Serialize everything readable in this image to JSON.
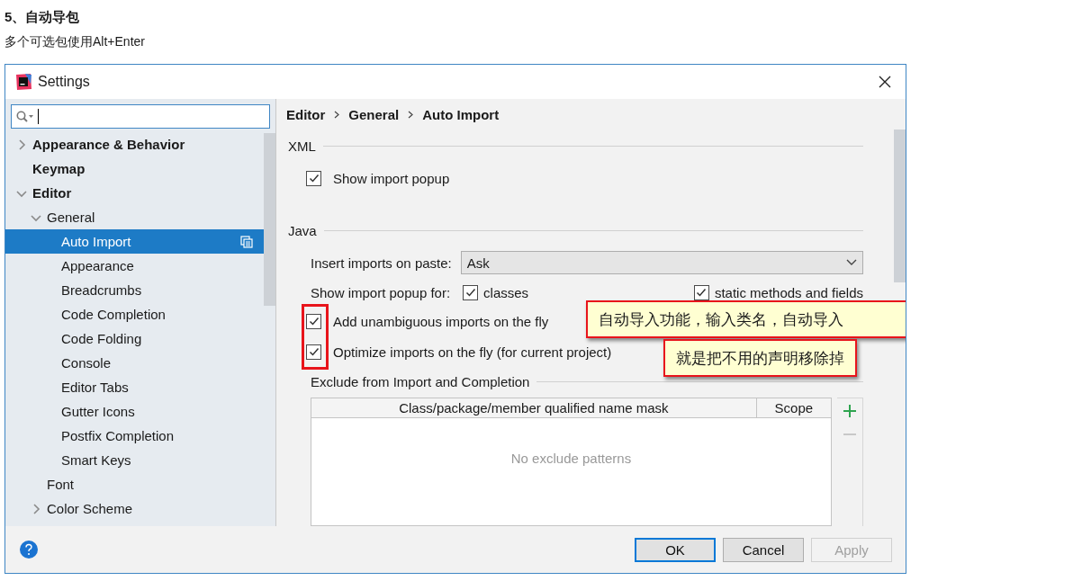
{
  "article": {
    "heading": "5、自动导包",
    "subtitle": "多个可选包使用Alt+Enter"
  },
  "window": {
    "title": "Settings"
  },
  "sidebar": {
    "items": [
      {
        "label": "Appearance & Behavior",
        "expanded": false,
        "selected": false
      },
      {
        "label": "Keymap",
        "selected": false
      },
      {
        "label": "Editor",
        "expanded": true,
        "selected": false,
        "children": [
          {
            "label": "General",
            "expanded": true,
            "selected": false,
            "children": [
              {
                "label": "Auto Import",
                "selected": true,
                "project_scope": true
              },
              {
                "label": "Appearance",
                "selected": false
              },
              {
                "label": "Breadcrumbs",
                "selected": false
              },
              {
                "label": "Code Completion",
                "selected": false
              },
              {
                "label": "Code Folding",
                "selected": false
              },
              {
                "label": "Console",
                "selected": false
              },
              {
                "label": "Editor Tabs",
                "selected": false
              },
              {
                "label": "Gutter Icons",
                "selected": false
              },
              {
                "label": "Postfix Completion",
                "selected": false
              },
              {
                "label": "Smart Keys",
                "selected": false
              }
            ]
          },
          {
            "label": "Font",
            "selected": false
          },
          {
            "label": "Color Scheme",
            "expanded": false,
            "selected": false
          }
        ]
      }
    ]
  },
  "breadcrumb": [
    "Editor",
    "General",
    "Auto Import"
  ],
  "xml": {
    "title": "XML",
    "option": {
      "label": "Show import popup",
      "checked": true
    }
  },
  "java": {
    "title": "Java",
    "insert_imports": {
      "label": "Insert imports on paste:",
      "value": "Ask"
    },
    "popup_for": {
      "label": "Show import popup for:",
      "options": [
        {
          "label": "classes",
          "checked": true
        },
        {
          "label": "static methods and fields",
          "checked": true
        }
      ]
    },
    "options": [
      {
        "label": "Add unambiguous imports on the fly",
        "checked": true
      },
      {
        "label": "Optimize imports on the fly (for current project)",
        "checked": true
      }
    ]
  },
  "exclude": {
    "title": "Exclude from Import and Completion",
    "columns": [
      "Class/package/member qualified name mask",
      "Scope"
    ],
    "empty_text": "No exclude patterns"
  },
  "callouts": [
    {
      "text": "自动导入功能，输入类名，自动导入"
    },
    {
      "text": "就是把不用的声明移除掉"
    }
  ],
  "buttons": [
    {
      "label": "OK",
      "default": true,
      "disabled": false
    },
    {
      "label": "Cancel",
      "default": false,
      "disabled": false
    },
    {
      "label": "Apply",
      "default": false,
      "disabled": true
    }
  ]
}
